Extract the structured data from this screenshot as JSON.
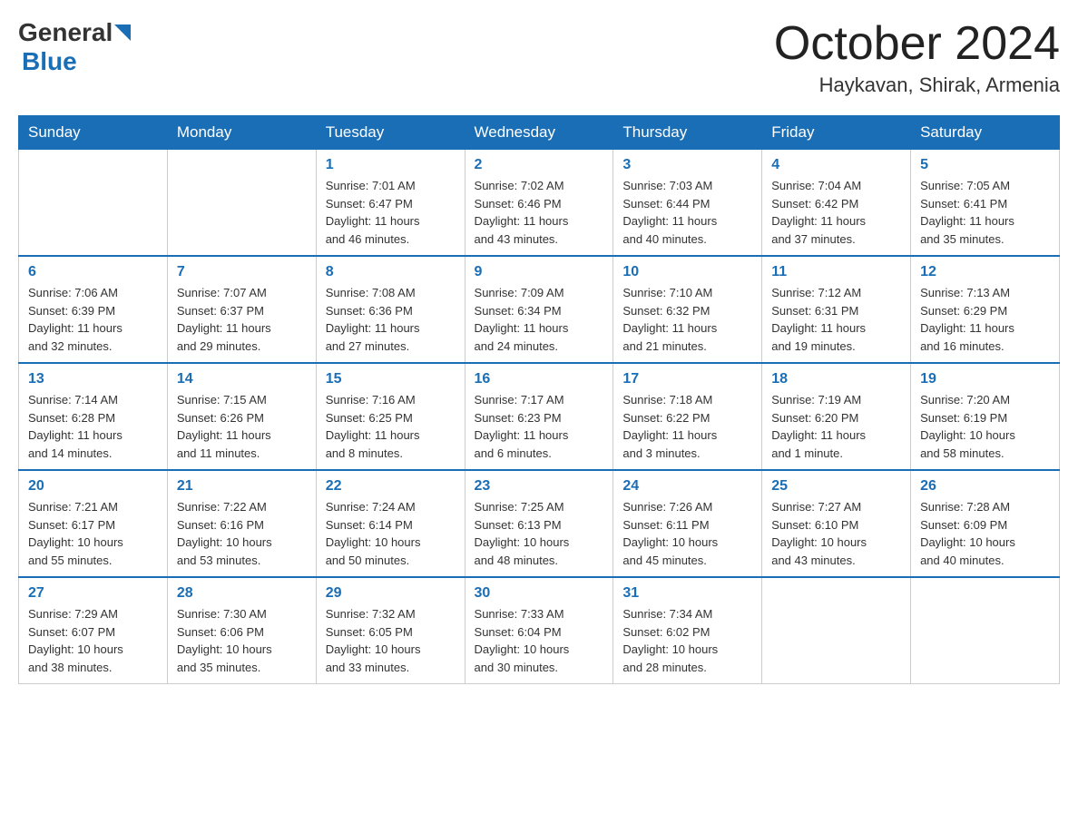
{
  "header": {
    "logo_general": "General",
    "logo_blue": "Blue",
    "month_title": "October 2024",
    "location": "Haykavan, Shirak, Armenia"
  },
  "days_of_week": [
    "Sunday",
    "Monday",
    "Tuesday",
    "Wednesday",
    "Thursday",
    "Friday",
    "Saturday"
  ],
  "weeks": [
    [
      {
        "day": "",
        "info": ""
      },
      {
        "day": "",
        "info": ""
      },
      {
        "day": "1",
        "info": "Sunrise: 7:01 AM\nSunset: 6:47 PM\nDaylight: 11 hours\nand 46 minutes."
      },
      {
        "day": "2",
        "info": "Sunrise: 7:02 AM\nSunset: 6:46 PM\nDaylight: 11 hours\nand 43 minutes."
      },
      {
        "day": "3",
        "info": "Sunrise: 7:03 AM\nSunset: 6:44 PM\nDaylight: 11 hours\nand 40 minutes."
      },
      {
        "day": "4",
        "info": "Sunrise: 7:04 AM\nSunset: 6:42 PM\nDaylight: 11 hours\nand 37 minutes."
      },
      {
        "day": "5",
        "info": "Sunrise: 7:05 AM\nSunset: 6:41 PM\nDaylight: 11 hours\nand 35 minutes."
      }
    ],
    [
      {
        "day": "6",
        "info": "Sunrise: 7:06 AM\nSunset: 6:39 PM\nDaylight: 11 hours\nand 32 minutes."
      },
      {
        "day": "7",
        "info": "Sunrise: 7:07 AM\nSunset: 6:37 PM\nDaylight: 11 hours\nand 29 minutes."
      },
      {
        "day": "8",
        "info": "Sunrise: 7:08 AM\nSunset: 6:36 PM\nDaylight: 11 hours\nand 27 minutes."
      },
      {
        "day": "9",
        "info": "Sunrise: 7:09 AM\nSunset: 6:34 PM\nDaylight: 11 hours\nand 24 minutes."
      },
      {
        "day": "10",
        "info": "Sunrise: 7:10 AM\nSunset: 6:32 PM\nDaylight: 11 hours\nand 21 minutes."
      },
      {
        "day": "11",
        "info": "Sunrise: 7:12 AM\nSunset: 6:31 PM\nDaylight: 11 hours\nand 19 minutes."
      },
      {
        "day": "12",
        "info": "Sunrise: 7:13 AM\nSunset: 6:29 PM\nDaylight: 11 hours\nand 16 minutes."
      }
    ],
    [
      {
        "day": "13",
        "info": "Sunrise: 7:14 AM\nSunset: 6:28 PM\nDaylight: 11 hours\nand 14 minutes."
      },
      {
        "day": "14",
        "info": "Sunrise: 7:15 AM\nSunset: 6:26 PM\nDaylight: 11 hours\nand 11 minutes."
      },
      {
        "day": "15",
        "info": "Sunrise: 7:16 AM\nSunset: 6:25 PM\nDaylight: 11 hours\nand 8 minutes."
      },
      {
        "day": "16",
        "info": "Sunrise: 7:17 AM\nSunset: 6:23 PM\nDaylight: 11 hours\nand 6 minutes."
      },
      {
        "day": "17",
        "info": "Sunrise: 7:18 AM\nSunset: 6:22 PM\nDaylight: 11 hours\nand 3 minutes."
      },
      {
        "day": "18",
        "info": "Sunrise: 7:19 AM\nSunset: 6:20 PM\nDaylight: 11 hours\nand 1 minute."
      },
      {
        "day": "19",
        "info": "Sunrise: 7:20 AM\nSunset: 6:19 PM\nDaylight: 10 hours\nand 58 minutes."
      }
    ],
    [
      {
        "day": "20",
        "info": "Sunrise: 7:21 AM\nSunset: 6:17 PM\nDaylight: 10 hours\nand 55 minutes."
      },
      {
        "day": "21",
        "info": "Sunrise: 7:22 AM\nSunset: 6:16 PM\nDaylight: 10 hours\nand 53 minutes."
      },
      {
        "day": "22",
        "info": "Sunrise: 7:24 AM\nSunset: 6:14 PM\nDaylight: 10 hours\nand 50 minutes."
      },
      {
        "day": "23",
        "info": "Sunrise: 7:25 AM\nSunset: 6:13 PM\nDaylight: 10 hours\nand 48 minutes."
      },
      {
        "day": "24",
        "info": "Sunrise: 7:26 AM\nSunset: 6:11 PM\nDaylight: 10 hours\nand 45 minutes."
      },
      {
        "day": "25",
        "info": "Sunrise: 7:27 AM\nSunset: 6:10 PM\nDaylight: 10 hours\nand 43 minutes."
      },
      {
        "day": "26",
        "info": "Sunrise: 7:28 AM\nSunset: 6:09 PM\nDaylight: 10 hours\nand 40 minutes."
      }
    ],
    [
      {
        "day": "27",
        "info": "Sunrise: 7:29 AM\nSunset: 6:07 PM\nDaylight: 10 hours\nand 38 minutes."
      },
      {
        "day": "28",
        "info": "Sunrise: 7:30 AM\nSunset: 6:06 PM\nDaylight: 10 hours\nand 35 minutes."
      },
      {
        "day": "29",
        "info": "Sunrise: 7:32 AM\nSunset: 6:05 PM\nDaylight: 10 hours\nand 33 minutes."
      },
      {
        "day": "30",
        "info": "Sunrise: 7:33 AM\nSunset: 6:04 PM\nDaylight: 10 hours\nand 30 minutes."
      },
      {
        "day": "31",
        "info": "Sunrise: 7:34 AM\nSunset: 6:02 PM\nDaylight: 10 hours\nand 28 minutes."
      },
      {
        "day": "",
        "info": ""
      },
      {
        "day": "",
        "info": ""
      }
    ]
  ]
}
